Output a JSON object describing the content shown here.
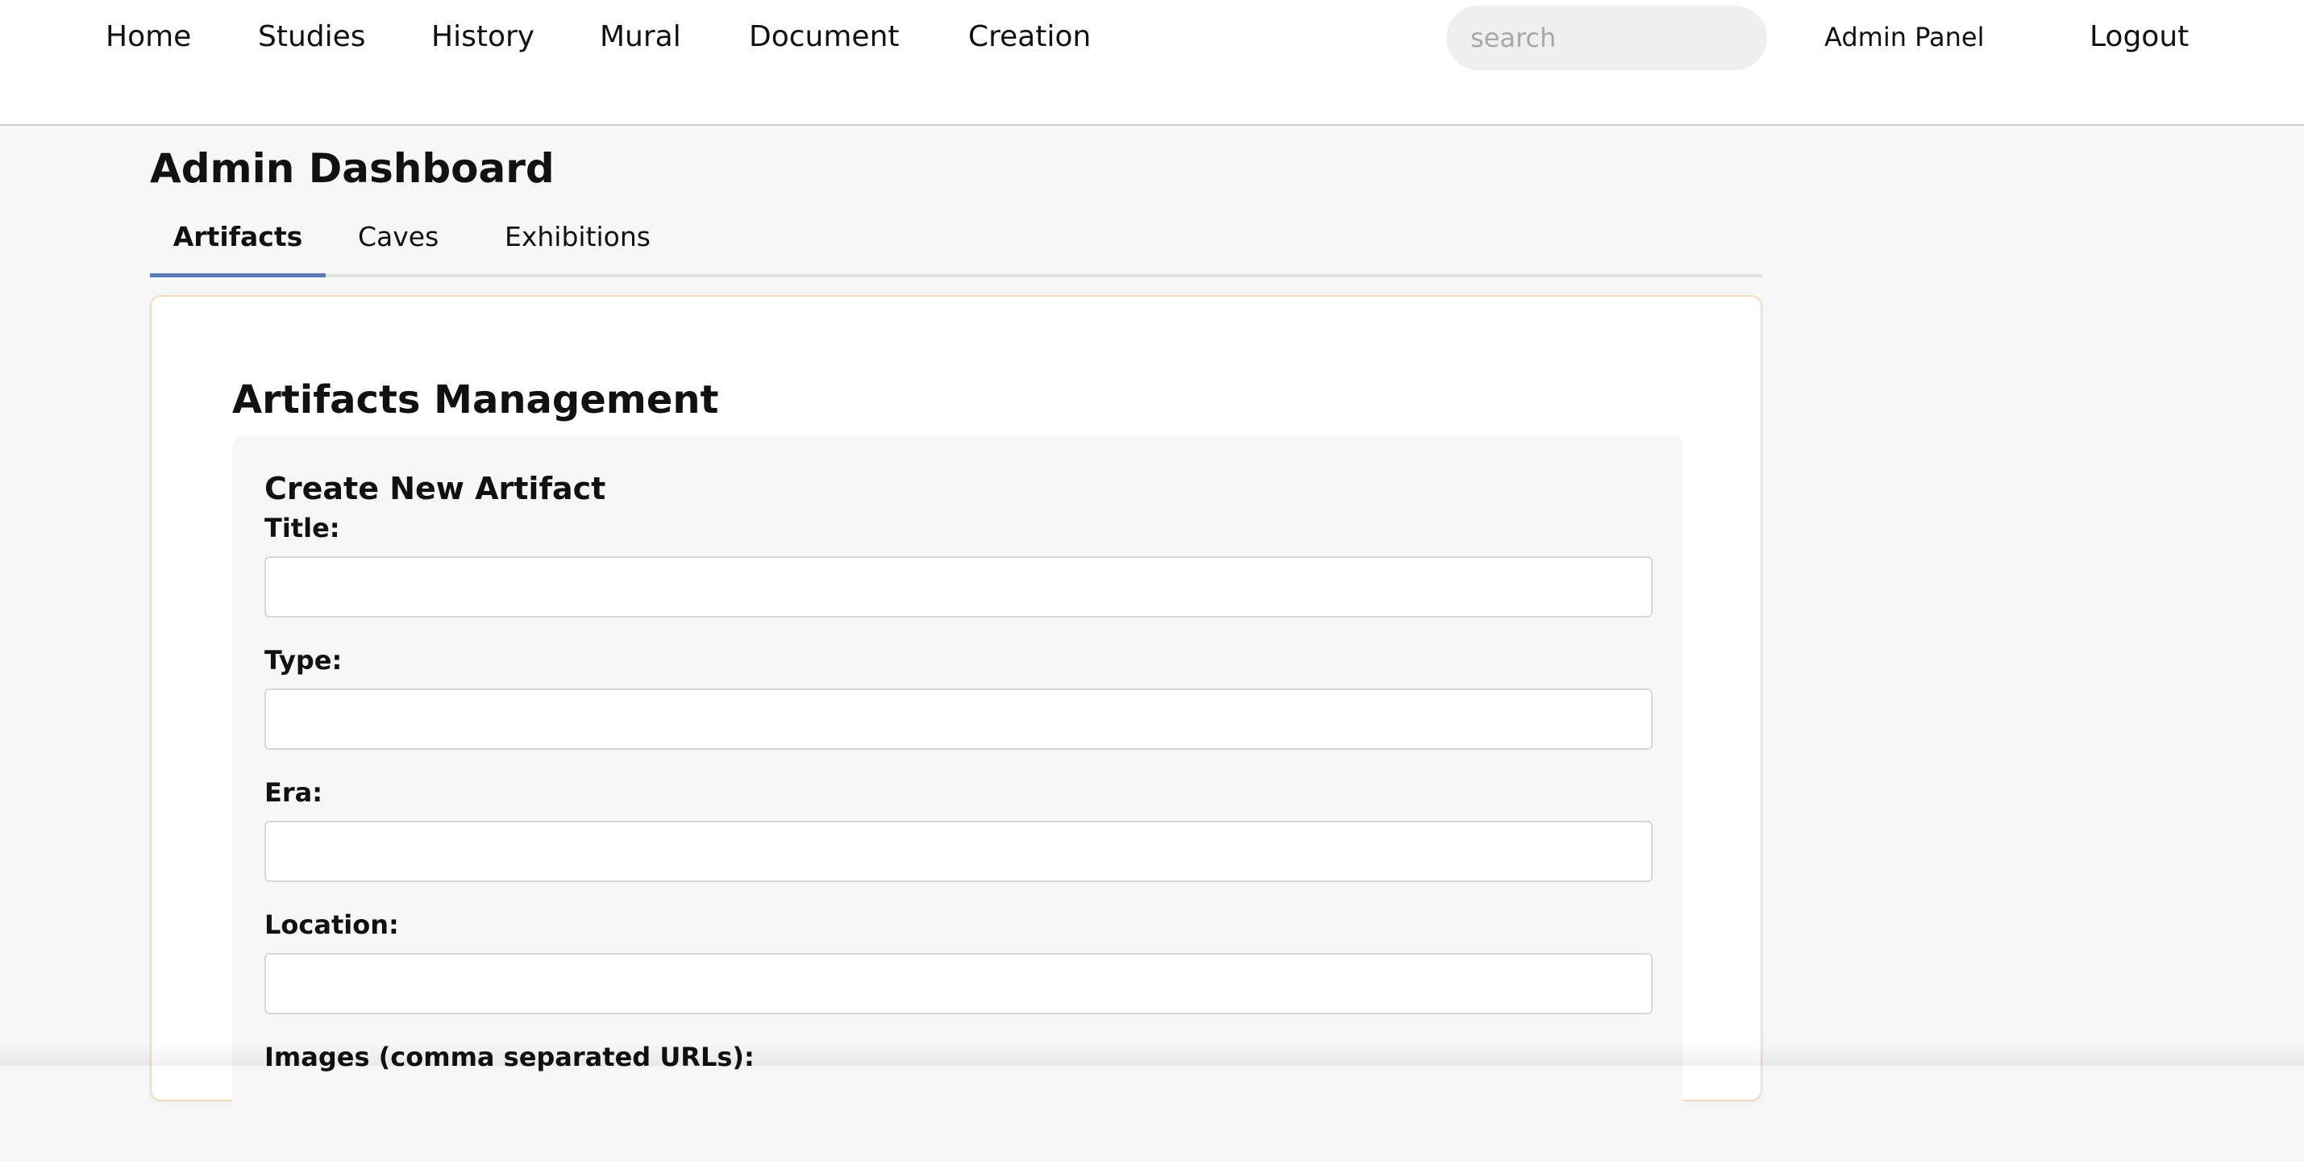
{
  "nav": {
    "items": [
      {
        "label": "Home"
      },
      {
        "label": "Studies"
      },
      {
        "label": "History"
      },
      {
        "label": "Mural"
      },
      {
        "label": "Document"
      },
      {
        "label": "Creation"
      }
    ],
    "search": {
      "placeholder": "search",
      "value": ""
    },
    "admin_label": "Admin Panel",
    "logout_label": "Logout"
  },
  "dashboard": {
    "title": "Admin Dashboard",
    "tabs": [
      {
        "label": "Artifacts",
        "active": true
      },
      {
        "label": "Caves",
        "active": false
      },
      {
        "label": "Exhibitions",
        "active": false
      }
    ]
  },
  "artifacts": {
    "section_title": "Artifacts Management",
    "form": {
      "heading": "Create New Artifact",
      "fields": [
        {
          "label": "Title:",
          "value": ""
        },
        {
          "label": "Type:",
          "value": ""
        },
        {
          "label": "Era:",
          "value": ""
        },
        {
          "label": "Location:",
          "value": ""
        },
        {
          "label": "Images (comma separated URLs):",
          "value": ""
        }
      ]
    }
  },
  "colors": {
    "tab_active_underline": "#5b7bb8",
    "card_border": "#f2dcc0",
    "page_background": "#f7f7f7"
  }
}
